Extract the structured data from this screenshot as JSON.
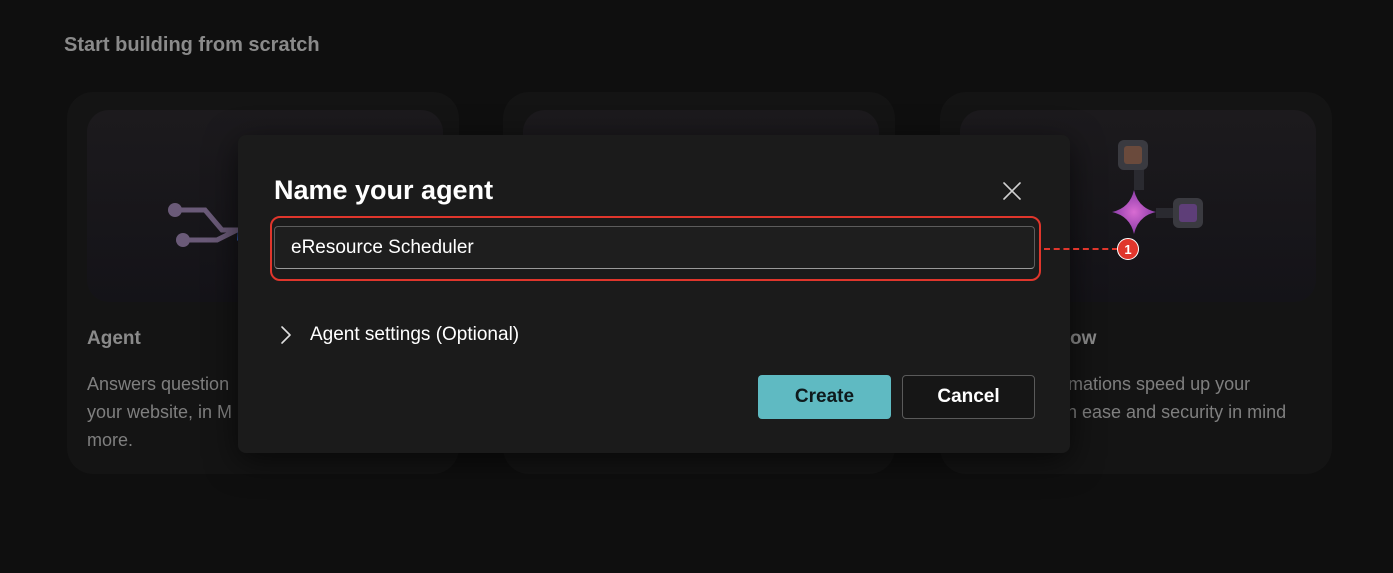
{
  "page": {
    "section_title": "Start building from scratch"
  },
  "cards": [
    {
      "title": "Agent",
      "description": "Answers question… your website, in M… more.",
      "desc_lines": [
        "Answers question",
        "your website, in M",
        "more."
      ],
      "icon": "agent-diagram-icon"
    },
    {
      "title": "",
      "description": "",
      "icon": "blank-card-art"
    },
    {
      "title": "ow",
      "desc_lines": [
        "omations speed up your",
        "ch ease and security in mind"
      ],
      "icon": "flow-sparkle-icon"
    }
  ],
  "dialog": {
    "title": "Name your agent",
    "close_icon": "close-icon",
    "name_value": "eResource Scheduler",
    "settings_label": "Agent settings (Optional)",
    "settings_icon": "chevron-right-icon",
    "create_label": "Create",
    "cancel_label": "Cancel"
  },
  "annotation": {
    "badge": "1",
    "color": "#e0362c"
  },
  "colors": {
    "accent": "#5fbac2",
    "background": "#0f0f0f",
    "dialog": "#1b1b1b",
    "highlight": "#e0362c"
  }
}
